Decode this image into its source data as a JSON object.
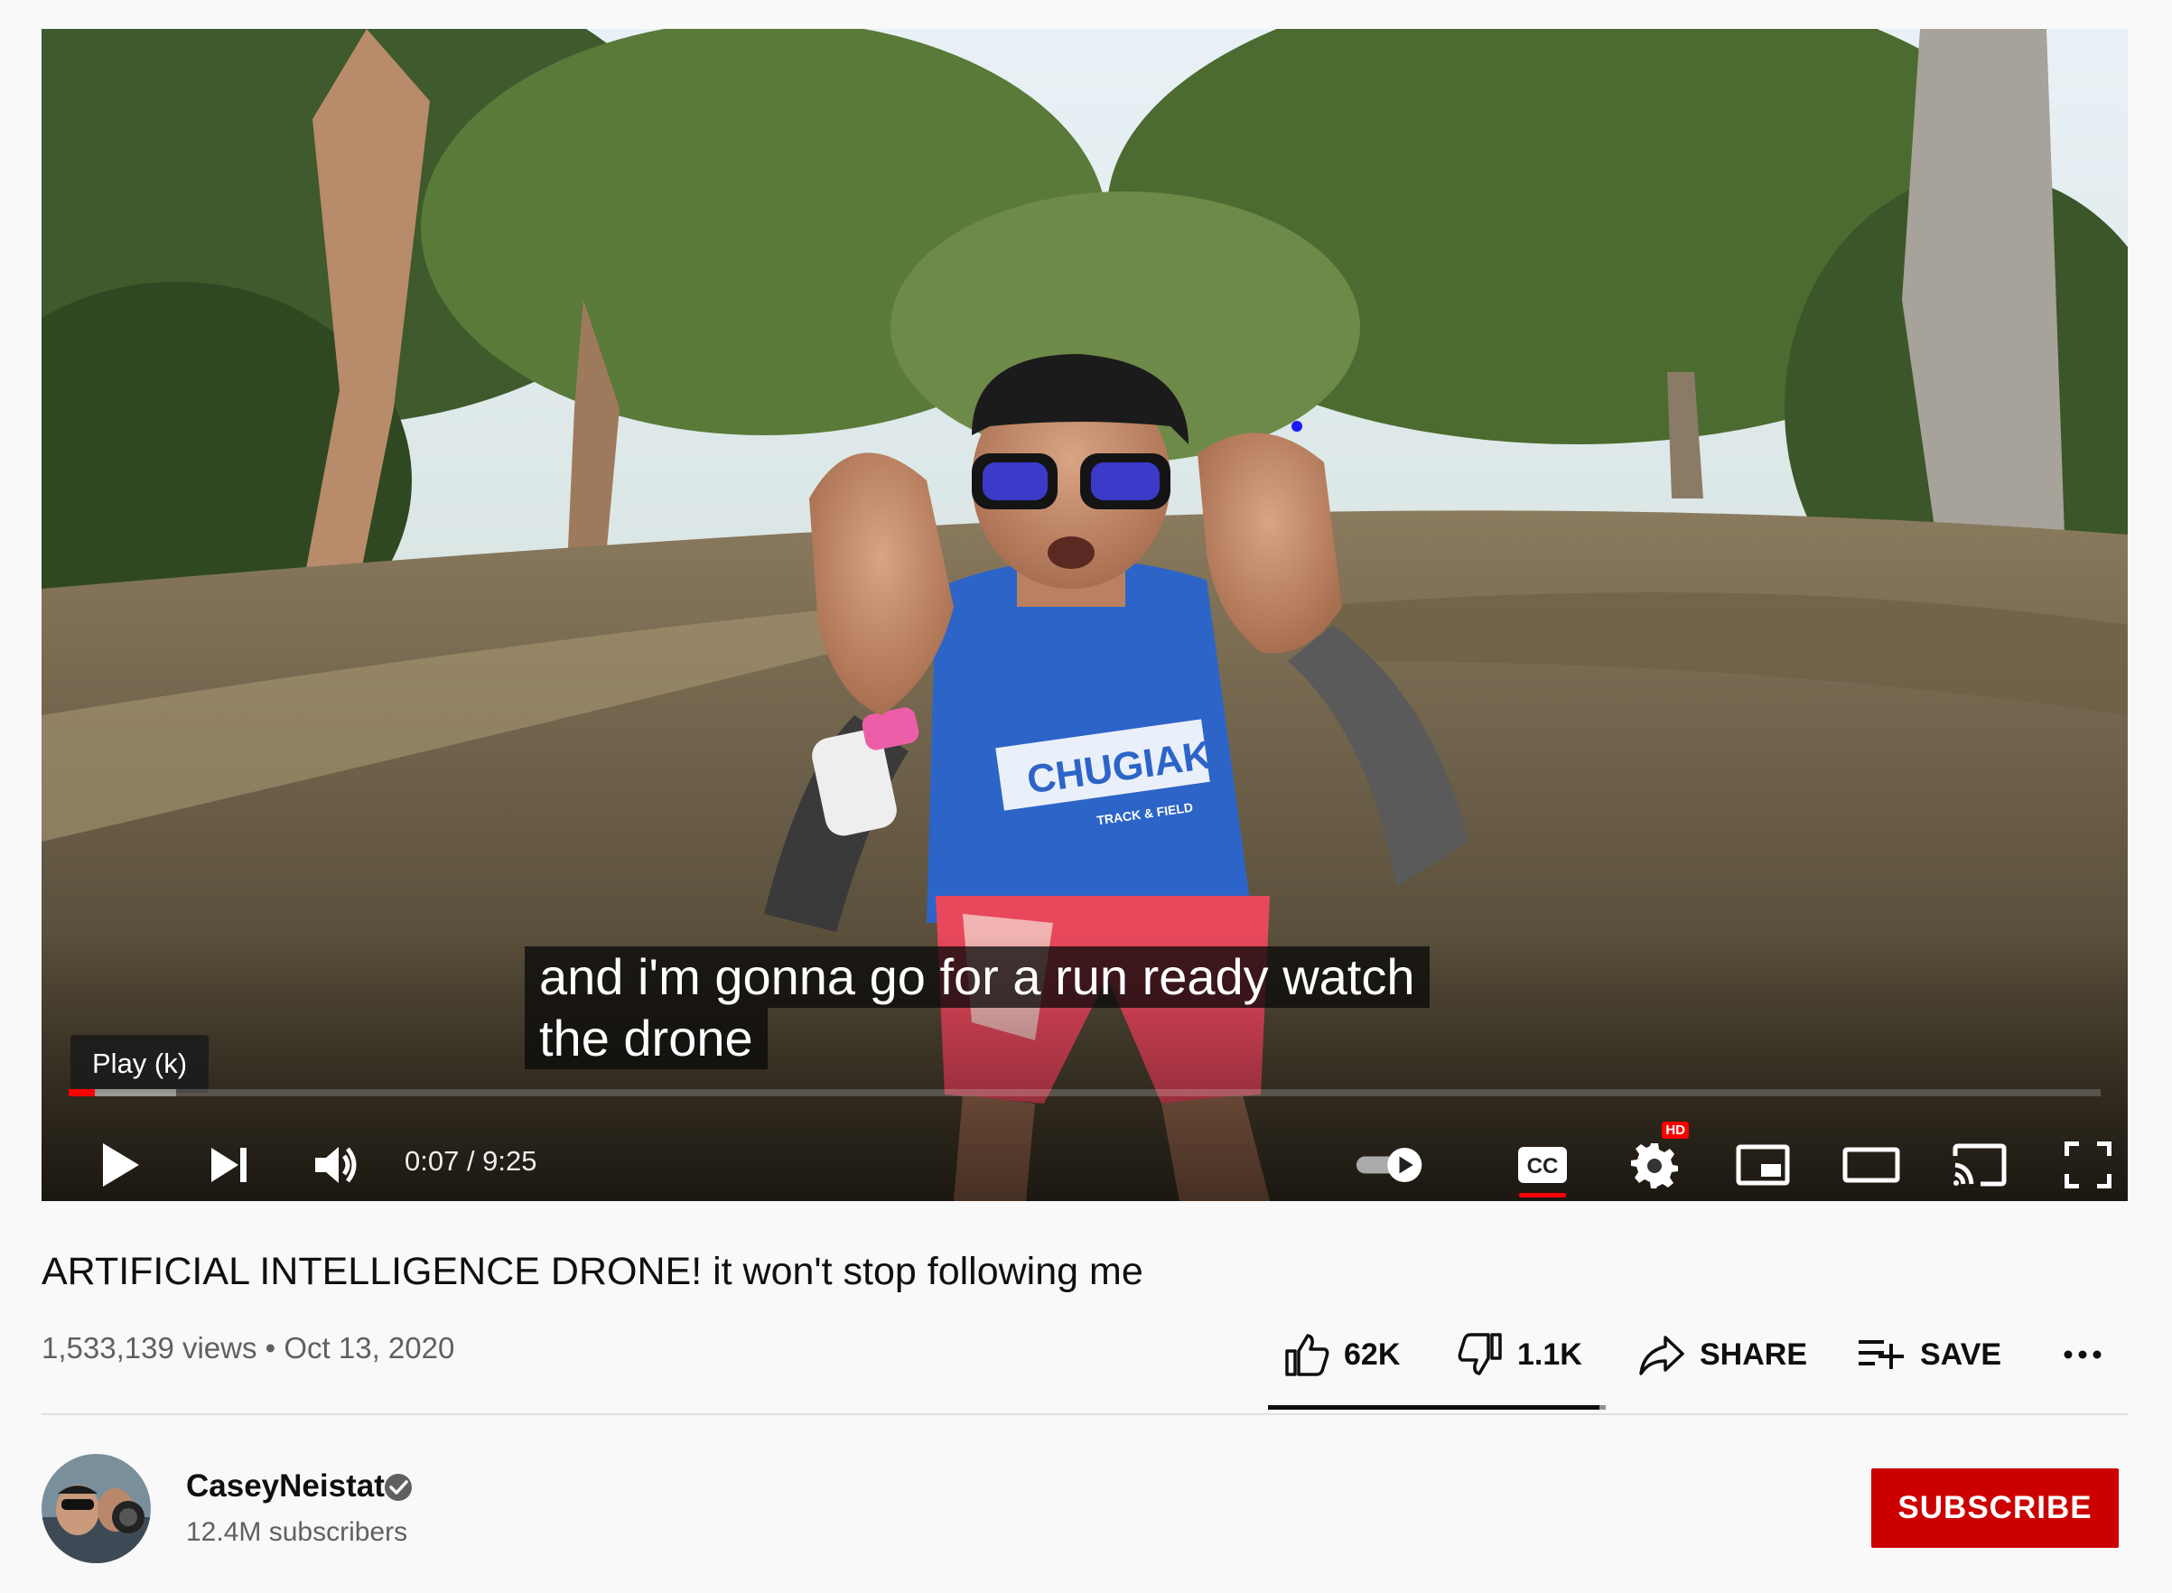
{
  "player": {
    "caption_line1": "and i'm gonna go for a run ready watch",
    "caption_line2": "the drone",
    "tooltip": "Play (k)",
    "time_display": "0:07 / 9:25",
    "progress_played_fraction": 0.013,
    "progress_loaded_fraction": 0.053,
    "hd_badge": "HD",
    "shirt_text": "CHUGIAK",
    "shirt_subtext": "TRACK & FIELD",
    "controls": [
      "play-icon",
      "next-icon",
      "volume-icon",
      "autoplay-toggle-icon",
      "cc-icon",
      "settings-icon",
      "miniplayer-icon",
      "theater-icon",
      "cast-icon",
      "fullscreen-icon"
    ]
  },
  "video": {
    "title": "ARTIFICIAL INTELLIGENCE DRONE! it won't stop following me",
    "meta": "1,533,139 views • Oct 13, 2020"
  },
  "actions": {
    "like_count": "62K",
    "dislike_count": "1.1K",
    "share_label": "SHARE",
    "save_label": "SAVE",
    "like_ratio": 0.98
  },
  "channel": {
    "name": "CaseyNeistat",
    "subscribers": "12.4M subscribers",
    "subscribe_label": "SUBSCRIBE"
  },
  "colors": {
    "accent": "#ff0000",
    "subscribe_bg": "#cc0000",
    "text_primary": "#0f0f0f",
    "text_secondary": "#606060"
  }
}
